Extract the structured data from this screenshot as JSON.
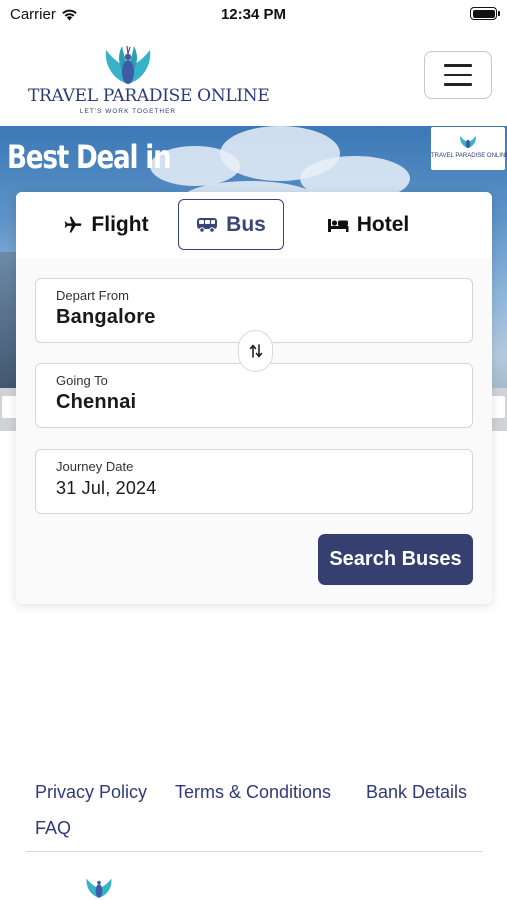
{
  "status_bar": {
    "carrier": "Carrier",
    "time": "12:34 PM"
  },
  "header": {
    "brand_name": "TRAVEL PARADISE ONLINE",
    "tagline": "LET'S WORK TOGETHER",
    "menu_icon": "hamburger-menu-icon"
  },
  "banner": {
    "headline": "Best Deal in",
    "mini_logo_text": "TRAVEL PARADISE ONLINE"
  },
  "booking": {
    "tabs": [
      {
        "label": "Flight",
        "icon": "airplane-icon",
        "selected": false
      },
      {
        "label": "Bus",
        "icon": "bus-icon",
        "selected": true
      },
      {
        "label": "Hotel",
        "icon": "bed-icon",
        "selected": false
      }
    ],
    "depart_from": {
      "label": "Depart From",
      "value": "Bangalore"
    },
    "going_to": {
      "label": "Going To",
      "value": "Chennai"
    },
    "journey_date": {
      "label": "Journey Date",
      "value": "31 Jul, 2024"
    },
    "swap_icon": "swap-arrows-icon",
    "search_label": "Search Buses"
  },
  "footer": {
    "links": [
      "Privacy Policy",
      "Terms & Conditions",
      "Bank Details",
      "FAQ"
    ]
  },
  "colors": {
    "brand_navy": "#353f70",
    "brand_teal": "#37b3c7",
    "link_color": "#2f3a7a"
  }
}
